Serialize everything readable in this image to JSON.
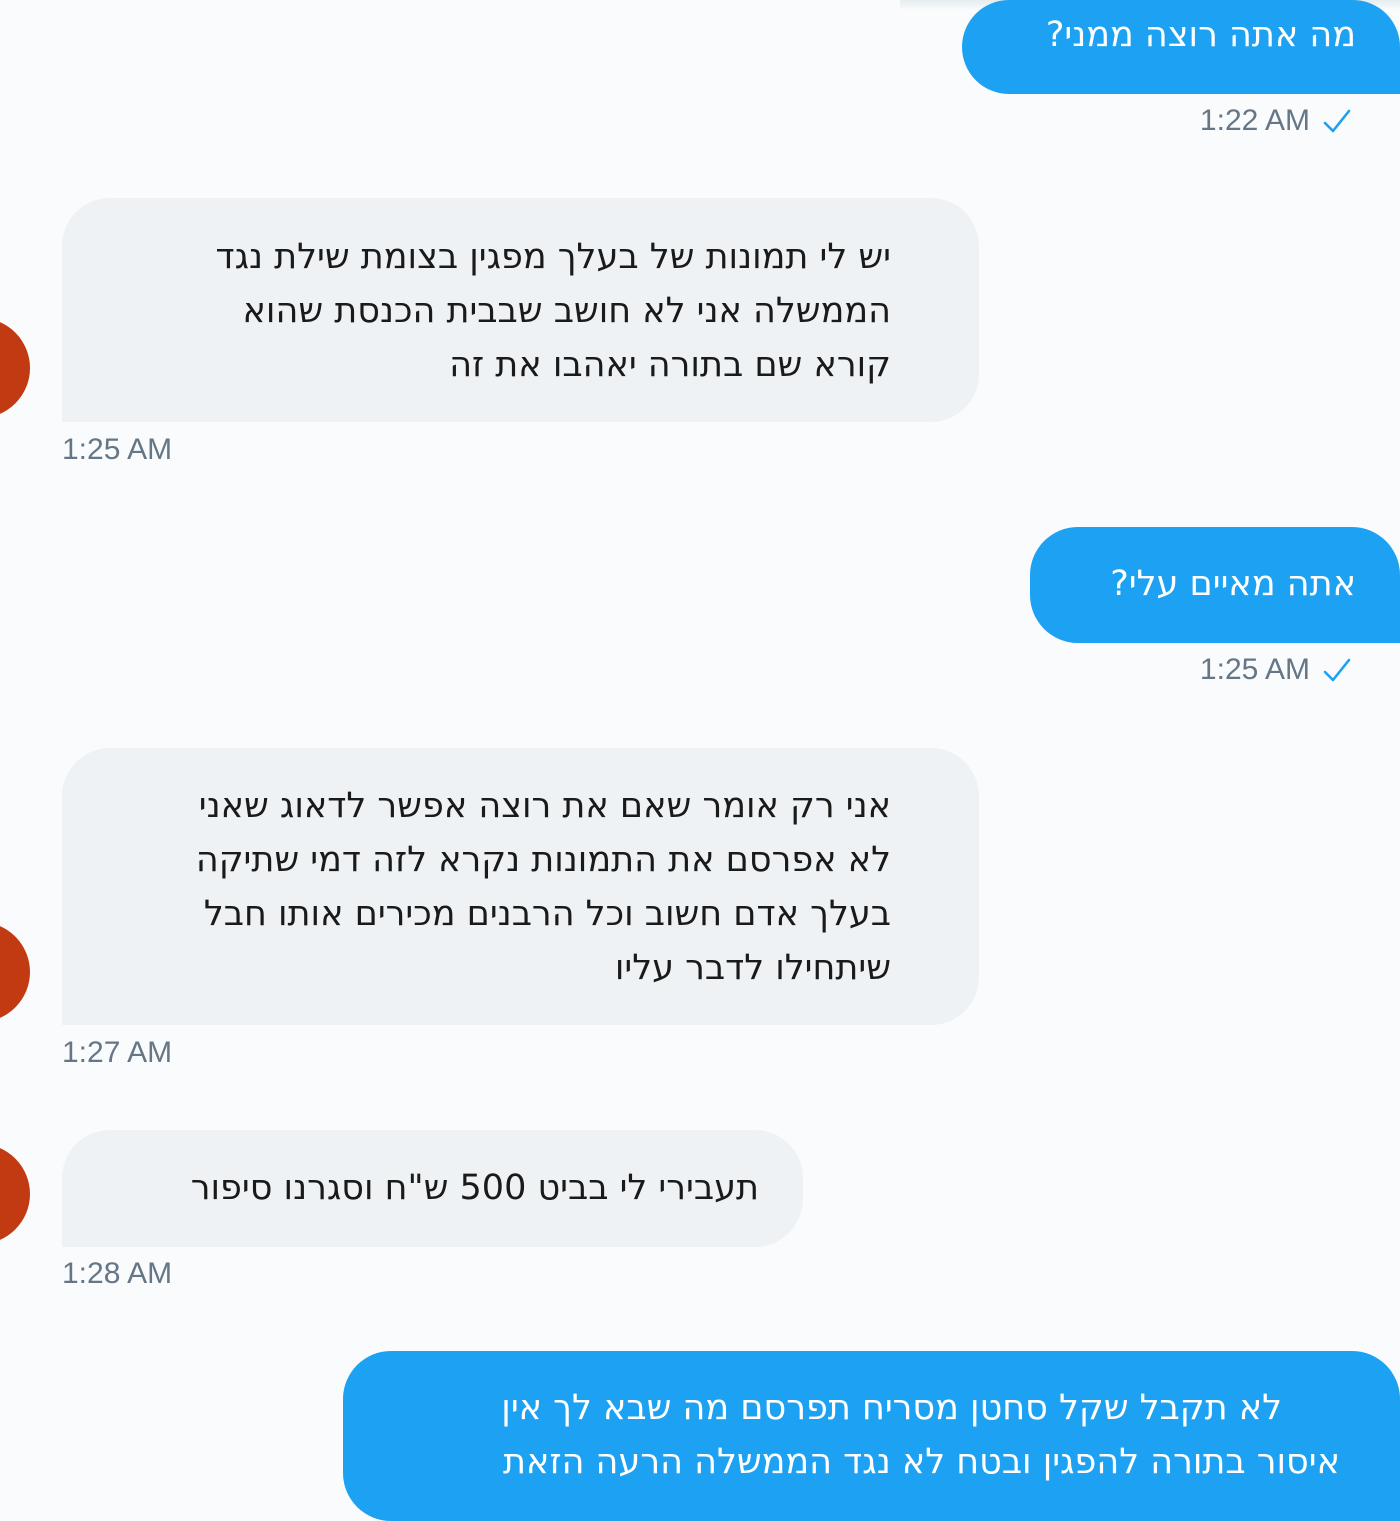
{
  "conversation": {
    "messages": [
      {
        "direction": "outgoing",
        "lines": [
          "מה אתה רוצה ממני?"
        ],
        "time": "1:22 AM"
      },
      {
        "direction": "incoming",
        "lines": [
          "יש לי תמונות של בעלך מפגין בצומת שילת נגד",
          "הממשלה אני לא חושב שבבית הכנסת שהוא",
          "קורא שם בתורה יאהבו את זה"
        ],
        "time": "1:25 AM"
      },
      {
        "direction": "outgoing",
        "lines": [
          "אתה מאיים עלי?"
        ],
        "time": "1:25 AM"
      },
      {
        "direction": "incoming",
        "lines": [
          "אני רק אומר שאם את רוצה אפשר לדאוג שאני",
          "לא אפרסם את התמונות נקרא לזה דמי שתיקה",
          "בעלך אדם חשוב וכל הרבנים מכירים אותו חבל",
          "שיתחילו לדבר עליו"
        ],
        "time": "1:27 AM"
      },
      {
        "direction": "incoming",
        "lines": [
          "תעבירי לי בביט 500 ש\"ח וסגרנו סיפור"
        ],
        "time": "1:28 AM"
      },
      {
        "direction": "outgoing",
        "lines": [
          "לא תקבל שקל סחטן מסריח תפרסם מה שבא לך אין",
          "איסור בתורה להפגין ובטח לא נגד הממשלה הרעה הזאת"
        ],
        "time": ""
      }
    ]
  },
  "icons": {
    "read_receipt": "checkmark-icon",
    "avatar": "user-avatar"
  },
  "colors": {
    "outgoing_bubble": "#1da1f2",
    "incoming_bubble": "#eff2f4",
    "timestamp": "#657786",
    "avatar": "#c23a12",
    "checkmark": "#1da1f2"
  }
}
